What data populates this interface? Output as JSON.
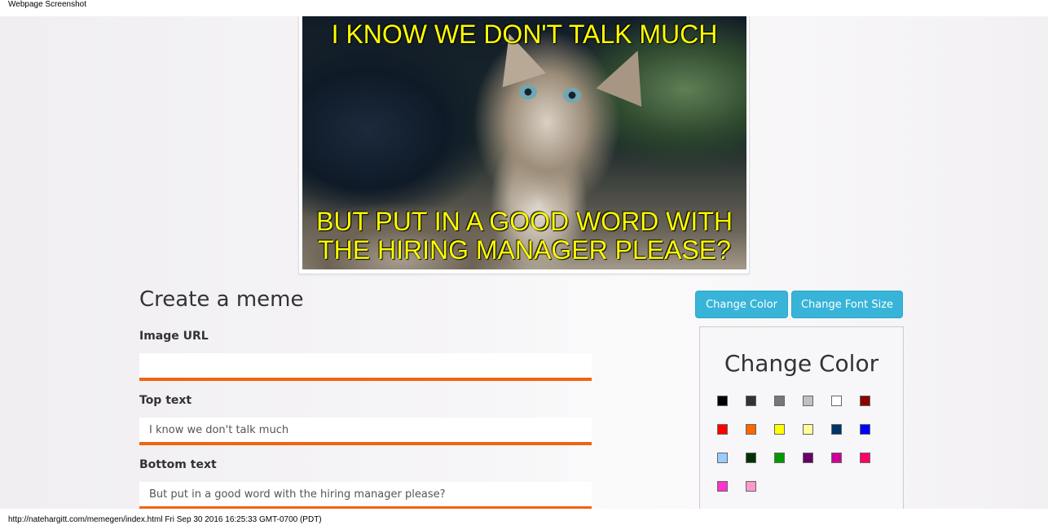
{
  "header_label": "Webpage Screenshot",
  "footer_label": "http://natehargitt.com/memegen/index.html Fri Sep 30 2016 16:25:33 GMT-0700 (PDT)",
  "meme": {
    "top_text": "I KNOW WE DON'T TALK MUCH",
    "bottom_text": "BUT PUT IN A GOOD WORD WITH THE HIRING MANAGER PLEASE?",
    "text_color": "#ffff00"
  },
  "form": {
    "title": "Create a meme",
    "image_url_label": "Image URL",
    "image_url_value": "",
    "top_text_label": "Top text",
    "top_text_value": "I know we don't talk much",
    "bottom_text_label": "Bottom text",
    "bottom_text_value": "But put in a good word with the hiring manager please?",
    "accent_color": "#ee6511"
  },
  "toolbar": {
    "change_color_label": "Change Color",
    "change_font_size_label": "Change Font Size",
    "button_color": "#38b4d8"
  },
  "color_panel": {
    "title": "Change Color",
    "swatches": [
      "#000000",
      "#333333",
      "#777777",
      "#c0c0c0",
      "#ffffff",
      "#8b0000",
      "#ff0000",
      "#ff6600",
      "#ffff00",
      "#ffff99",
      "#003366",
      "#0000ff",
      "#99ccff",
      "#003300",
      "#009900",
      "#660066",
      "#cc0099",
      "#ff0066",
      "#ff33cc",
      "#ff99cc"
    ]
  }
}
